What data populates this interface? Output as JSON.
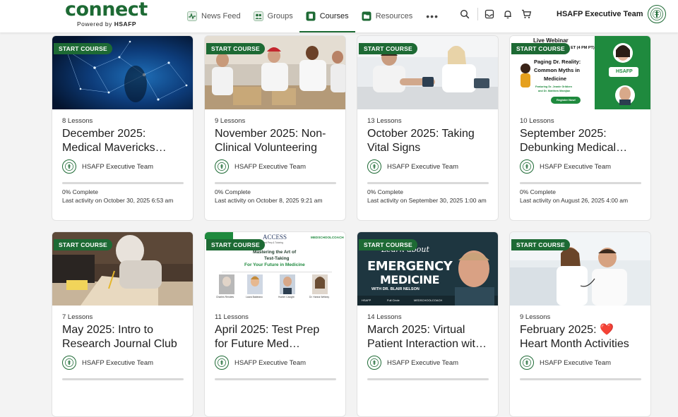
{
  "brand": {
    "word": "connect",
    "sub_prefix": "Powered by ",
    "sub_bold": "HSAFP"
  },
  "nav": [
    {
      "label": "News Feed",
      "icon": "activity-icon"
    },
    {
      "label": "Groups",
      "icon": "groups-icon"
    },
    {
      "label": "Courses",
      "icon": "book-icon",
      "active": true
    },
    {
      "label": "Resources",
      "icon": "folder-icon"
    }
  ],
  "nav_more": "•••",
  "user": {
    "name": "HSAFP Executive Team"
  },
  "colors": {
    "brand_green": "#1d6a34"
  },
  "courses": [
    {
      "badge": "START COURSE",
      "lessons": "8 Lessons",
      "title_lines": [
        "December 2025:",
        "Medical Mavericks…"
      ],
      "author": "HSAFP Executive Team",
      "progress_label": "0% Complete",
      "progress": 0,
      "last": "Last activity on October 30, 2025 6:53 am"
    },
    {
      "badge": "START COURSE",
      "lessons": "9 Lessons",
      "title_lines": [
        "November 2025: Non-",
        "Clinical Volunteering"
      ],
      "author": "HSAFP Executive Team",
      "progress_label": "0% Complete",
      "progress": 0,
      "last": "Last activity on October 8, 2025 9:21 am"
    },
    {
      "badge": "START COURSE",
      "lessons": "13 Lessons",
      "title_lines": [
        "October 2025: Taking",
        "Vital Signs"
      ],
      "author": "HSAFP Executive Team",
      "progress_label": "0% Complete",
      "progress": 0,
      "last": "Last activity on September 30, 2025 1:00 am"
    },
    {
      "badge": "START COURSE",
      "lessons": "10 Lessons",
      "title_lines": [
        "September 2025:",
        "Debunking Medical…"
      ],
      "author": "HSAFP Executive Team",
      "progress_label": "0% Complete",
      "progress": 0,
      "last": "Last activity on August 26, 2025 4:00 am"
    },
    {
      "badge": "START COURSE",
      "lessons": "7 Lessons",
      "title_lines": [
        "May 2025: Intro to",
        "Research Journal Club"
      ],
      "author": "HSAFP Executive Team"
    },
    {
      "badge": "START COURSE",
      "lessons": "11 Lessons",
      "title_lines": [
        "April 2025: Test Prep",
        "for Future Med…"
      ],
      "author": "HSAFP Executive Team"
    },
    {
      "badge": "START COURSE",
      "lessons": "14 Lessons",
      "title_lines": [
        "March 2025: Virtual",
        "Patient Interaction wit…"
      ],
      "author": "HSAFP Executive Team"
    },
    {
      "badge": "START COURSE",
      "lessons": "9 Lessons",
      "title_lines": [
        "February 2025: ❤️",
        "Heart Month Activities"
      ],
      "author": "HSAFP Executive Team"
    }
  ],
  "thumb_text": {
    "webinar": {
      "l1": "Live Webinar",
      "l2": "M ET (4 PM PT)",
      "l3": "Paging Dr. Reality:",
      "l4": "Common Myths in",
      "l5": "Medicine",
      "l6": "Featuring Dr. Jeanie Gribben",
      "l7": "and Dr. Matthew Mamjian",
      "btn": "Register Now!",
      "org": "HSAFP"
    },
    "testprep": {
      "a": "ACCESS",
      "a2": "Test Prep & Tutoring",
      "m": "MEDSCHOOLCOACH",
      "t1": "Mastering the Art of",
      "t2": "Test-Taking",
      "t3": "For Your Future in Medicine",
      "p1": "Charles Rendels",
      "p2": "Laura Baldeano",
      "p3": "Hunter Cavight",
      "p4": "Dr. Hanna Weltzky"
    },
    "emergency": {
      "t1": "Learn about",
      "t2": "EMERGENCY",
      "t3": "MEDICINE",
      "t4": "WITH DR. BLAIR NELSON",
      "f1": "HSAFP",
      "f2": "Full Circle",
      "f3": "MEDSCHOOLCOACH"
    }
  }
}
